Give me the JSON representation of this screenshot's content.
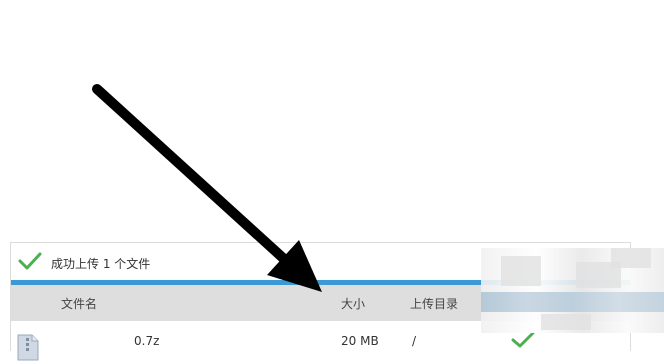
{
  "upload_panel": {
    "status_text": "成功上传 1 个文件",
    "columns": {
      "name": "文件名",
      "size": "大小",
      "directory": "上传目录"
    },
    "files": [
      {
        "name": "0.7z",
        "size": "20 MB",
        "directory": "/"
      }
    ]
  },
  "colors": {
    "success_green": "#4caf50",
    "progress_blue": "#3b9ad6",
    "header_gray": "#dedede"
  },
  "icons": [
    "check-icon",
    "archive-file-icon",
    "upload-complete-check-icon",
    "annotation-arrow"
  ]
}
